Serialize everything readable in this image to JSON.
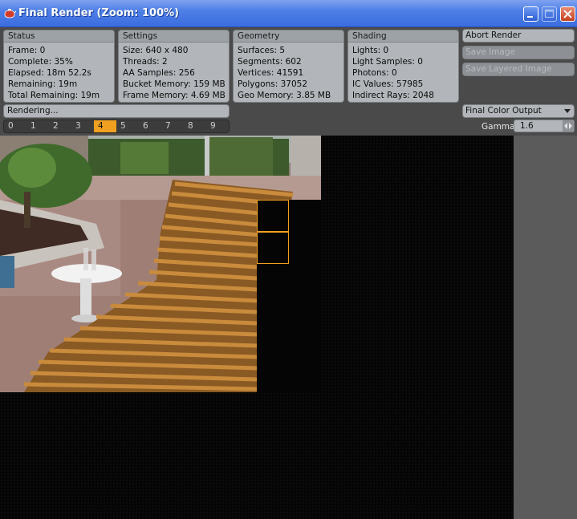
{
  "window": {
    "title": "Final Render (Zoom: 100%)"
  },
  "status": {
    "header": "Status",
    "rows": [
      "Frame: 0",
      "Complete: 35%",
      "Elapsed: 18m 52.2s",
      "Remaining: 19m",
      "Total Remaining: 19m"
    ]
  },
  "settings": {
    "header": "Settings",
    "rows": [
      "Size: 640 x 480",
      "Threads: 2",
      "AA Samples: 256",
      "Bucket Memory: 159 MB",
      "Frame Memory: 4.69 MB"
    ]
  },
  "geometry": {
    "header": "Geometry",
    "rows": [
      "Surfaces: 5",
      "Segments: 602",
      "Vertices: 41591",
      "Polygons: 37052",
      "Geo Memory: 3.85 MB"
    ]
  },
  "shading": {
    "header": "Shading",
    "rows": [
      "Lights: 0",
      "Light Samples: 0",
      "Photons: 0",
      "IC Values: 57985",
      "Indirect Rays: 2048"
    ]
  },
  "buttons": {
    "abort": "Abort Render",
    "save_image": "Save Image",
    "save_layered": "Save Layered Image"
  },
  "progress": {
    "status_text": "Rendering...",
    "complete_fraction": 0.35
  },
  "buckets": {
    "items": [
      "0",
      "1",
      "2",
      "3",
      "4",
      "5",
      "6",
      "7",
      "8",
      "9"
    ],
    "active_index": 4
  },
  "output": {
    "selected": "Final Color Output"
  },
  "gamma": {
    "label": "Gamma",
    "value": "1.6"
  },
  "colors": {
    "accent": "#f0a020",
    "panel": "#b2b6ba",
    "titlebar": "#3b6de0"
  },
  "icons": {
    "app": "render-teapot-icon",
    "minimize": "minimize-icon",
    "maximize": "maximize-icon",
    "close": "close-icon"
  }
}
